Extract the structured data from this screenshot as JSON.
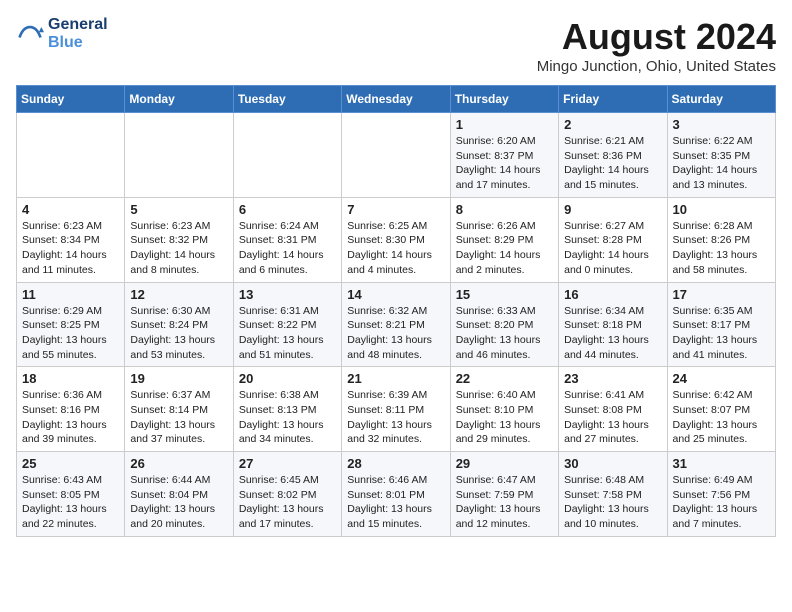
{
  "logo": {
    "line1": "General",
    "line2": "Blue"
  },
  "title": "August 2024",
  "subtitle": "Mingo Junction, Ohio, United States",
  "days_of_week": [
    "Sunday",
    "Monday",
    "Tuesday",
    "Wednesday",
    "Thursday",
    "Friday",
    "Saturday"
  ],
  "weeks": [
    [
      {
        "num": "",
        "info": ""
      },
      {
        "num": "",
        "info": ""
      },
      {
        "num": "",
        "info": ""
      },
      {
        "num": "",
        "info": ""
      },
      {
        "num": "1",
        "info": "Sunrise: 6:20 AM\nSunset: 8:37 PM\nDaylight: 14 hours\nand 17 minutes."
      },
      {
        "num": "2",
        "info": "Sunrise: 6:21 AM\nSunset: 8:36 PM\nDaylight: 14 hours\nand 15 minutes."
      },
      {
        "num": "3",
        "info": "Sunrise: 6:22 AM\nSunset: 8:35 PM\nDaylight: 14 hours\nand 13 minutes."
      }
    ],
    [
      {
        "num": "4",
        "info": "Sunrise: 6:23 AM\nSunset: 8:34 PM\nDaylight: 14 hours\nand 11 minutes."
      },
      {
        "num": "5",
        "info": "Sunrise: 6:23 AM\nSunset: 8:32 PM\nDaylight: 14 hours\nand 8 minutes."
      },
      {
        "num": "6",
        "info": "Sunrise: 6:24 AM\nSunset: 8:31 PM\nDaylight: 14 hours\nand 6 minutes."
      },
      {
        "num": "7",
        "info": "Sunrise: 6:25 AM\nSunset: 8:30 PM\nDaylight: 14 hours\nand 4 minutes."
      },
      {
        "num": "8",
        "info": "Sunrise: 6:26 AM\nSunset: 8:29 PM\nDaylight: 14 hours\nand 2 minutes."
      },
      {
        "num": "9",
        "info": "Sunrise: 6:27 AM\nSunset: 8:28 PM\nDaylight: 14 hours\nand 0 minutes."
      },
      {
        "num": "10",
        "info": "Sunrise: 6:28 AM\nSunset: 8:26 PM\nDaylight: 13 hours\nand 58 minutes."
      }
    ],
    [
      {
        "num": "11",
        "info": "Sunrise: 6:29 AM\nSunset: 8:25 PM\nDaylight: 13 hours\nand 55 minutes."
      },
      {
        "num": "12",
        "info": "Sunrise: 6:30 AM\nSunset: 8:24 PM\nDaylight: 13 hours\nand 53 minutes."
      },
      {
        "num": "13",
        "info": "Sunrise: 6:31 AM\nSunset: 8:22 PM\nDaylight: 13 hours\nand 51 minutes."
      },
      {
        "num": "14",
        "info": "Sunrise: 6:32 AM\nSunset: 8:21 PM\nDaylight: 13 hours\nand 48 minutes."
      },
      {
        "num": "15",
        "info": "Sunrise: 6:33 AM\nSunset: 8:20 PM\nDaylight: 13 hours\nand 46 minutes."
      },
      {
        "num": "16",
        "info": "Sunrise: 6:34 AM\nSunset: 8:18 PM\nDaylight: 13 hours\nand 44 minutes."
      },
      {
        "num": "17",
        "info": "Sunrise: 6:35 AM\nSunset: 8:17 PM\nDaylight: 13 hours\nand 41 minutes."
      }
    ],
    [
      {
        "num": "18",
        "info": "Sunrise: 6:36 AM\nSunset: 8:16 PM\nDaylight: 13 hours\nand 39 minutes."
      },
      {
        "num": "19",
        "info": "Sunrise: 6:37 AM\nSunset: 8:14 PM\nDaylight: 13 hours\nand 37 minutes."
      },
      {
        "num": "20",
        "info": "Sunrise: 6:38 AM\nSunset: 8:13 PM\nDaylight: 13 hours\nand 34 minutes."
      },
      {
        "num": "21",
        "info": "Sunrise: 6:39 AM\nSunset: 8:11 PM\nDaylight: 13 hours\nand 32 minutes."
      },
      {
        "num": "22",
        "info": "Sunrise: 6:40 AM\nSunset: 8:10 PM\nDaylight: 13 hours\nand 29 minutes."
      },
      {
        "num": "23",
        "info": "Sunrise: 6:41 AM\nSunset: 8:08 PM\nDaylight: 13 hours\nand 27 minutes."
      },
      {
        "num": "24",
        "info": "Sunrise: 6:42 AM\nSunset: 8:07 PM\nDaylight: 13 hours\nand 25 minutes."
      }
    ],
    [
      {
        "num": "25",
        "info": "Sunrise: 6:43 AM\nSunset: 8:05 PM\nDaylight: 13 hours\nand 22 minutes."
      },
      {
        "num": "26",
        "info": "Sunrise: 6:44 AM\nSunset: 8:04 PM\nDaylight: 13 hours\nand 20 minutes."
      },
      {
        "num": "27",
        "info": "Sunrise: 6:45 AM\nSunset: 8:02 PM\nDaylight: 13 hours\nand 17 minutes."
      },
      {
        "num": "28",
        "info": "Sunrise: 6:46 AM\nSunset: 8:01 PM\nDaylight: 13 hours\nand 15 minutes."
      },
      {
        "num": "29",
        "info": "Sunrise: 6:47 AM\nSunset: 7:59 PM\nDaylight: 13 hours\nand 12 minutes."
      },
      {
        "num": "30",
        "info": "Sunrise: 6:48 AM\nSunset: 7:58 PM\nDaylight: 13 hours\nand 10 minutes."
      },
      {
        "num": "31",
        "info": "Sunrise: 6:49 AM\nSunset: 7:56 PM\nDaylight: 13 hours\nand 7 minutes."
      }
    ]
  ]
}
